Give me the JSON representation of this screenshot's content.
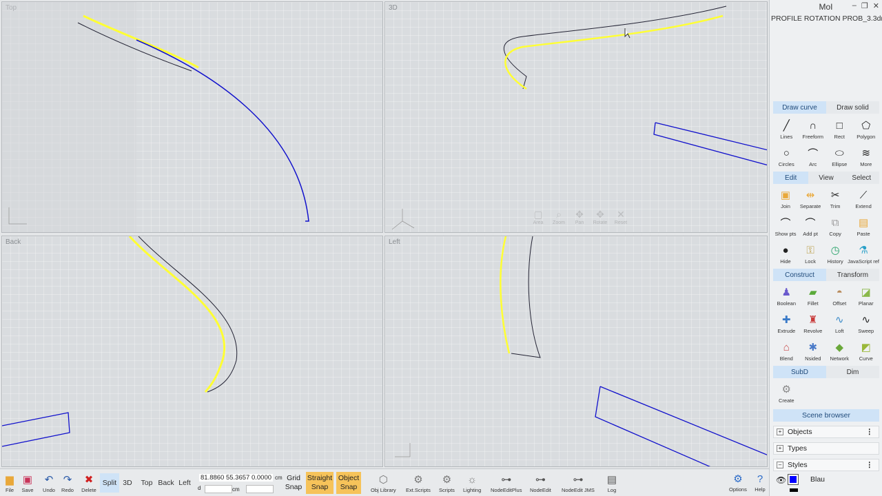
{
  "viewports": {
    "top": {
      "label": "Top"
    },
    "three_d": {
      "label": "3D",
      "nav": [
        "Area",
        "Zoom",
        "Pan",
        "Rotate",
        "Reset"
      ]
    },
    "back": {
      "label": "Back"
    },
    "left": {
      "label": "Left"
    }
  },
  "panel": {
    "app_title": "MoI",
    "file_name": "PROFILE ROTATION PROB_3.3dm*",
    "draw_tabs": [
      "Draw curve",
      "Draw solid"
    ],
    "draw_tools": [
      "Lines",
      "Freeform",
      "Rect",
      "Polygon",
      "Circles",
      "Arc",
      "Ellipse",
      "More"
    ],
    "edit_tabs": [
      "Edit",
      "View",
      "Select"
    ],
    "edit_tools": [
      "Join",
      "Separate",
      "Trim",
      "Extend",
      "Show pts",
      "Add pt",
      "Copy",
      "Paste",
      "Hide",
      "Lock",
      "History",
      "JavaScript ref"
    ],
    "construct_tabs": [
      "Construct",
      "Transform"
    ],
    "construct_tools": [
      "Boolean",
      "Fillet",
      "Offset",
      "Planar",
      "Extrude",
      "Revolve",
      "Loft",
      "Sweep",
      "Blend",
      "Nsided",
      "Network",
      "Curve"
    ],
    "subd_tabs": [
      "SubD",
      "Dim"
    ],
    "subd_tools": [
      "Create"
    ],
    "scene_browser": "Scene browser",
    "scene_items": [
      "Objects",
      "Types",
      "Styles"
    ],
    "style_name": "Blau",
    "style_color": "#0000ff"
  },
  "bottom": {
    "buttons": [
      "File",
      "Save",
      "Undo",
      "Redo",
      "Delete"
    ],
    "views": [
      "Split",
      "3D",
      "Top",
      "Back",
      "Left"
    ],
    "coords": "81.8860  55.3657  0.0000",
    "unit": "cm",
    "snaps": {
      "grid": "Grid Snap",
      "straight": "Straight Snap",
      "object": "Object Snap"
    },
    "scripts": [
      "Obj Library",
      "Ext.Scripts",
      "Scripts",
      "Lighting",
      "NodeEditPlus",
      "NodeEdit",
      "NodeEdit JMS",
      "Log"
    ],
    "right": [
      "Options",
      "Help"
    ]
  },
  "colors": {
    "accent_tab": "#cfe3f7",
    "snap_on": "#f6c35a",
    "curve_yellow": "#ffff33",
    "curve_blue": "#1010cc"
  }
}
